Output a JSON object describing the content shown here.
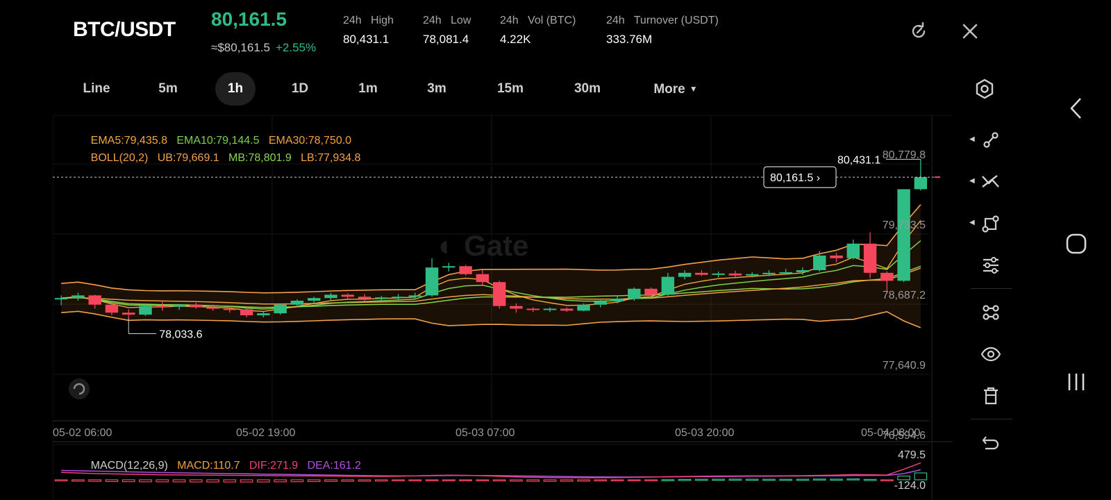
{
  "header": {
    "pair": "BTC/USDT",
    "price": "80,161.5",
    "fiat_price": "≈$80,161.5",
    "change": "+2.55%",
    "stats": [
      {
        "label": "24h   High",
        "value": "80,431.1"
      },
      {
        "label": "24h   Low",
        "value": "78,081.4"
      },
      {
        "label": "24h   Vol (BTC)",
        "value": "4.22K"
      },
      {
        "label": "24h   Turnover (USDT)",
        "value": "333.76M"
      }
    ]
  },
  "intervals": [
    "Line",
    "5m",
    "1h",
    "1D",
    "1m",
    "3m",
    "15m",
    "30m"
  ],
  "more_label": "More",
  "selected_interval": "1h",
  "watermark": "Gate",
  "legend": {
    "ema5": "EMA5:79,435.8",
    "ema10": "EMA10:79,144.5",
    "ema30": "EMA30:78,750.0",
    "boll": "BOLL(20,2)",
    "ub": "UB:79,669.1",
    "mb": "MB:78,801.9",
    "lb": "LB:77,934.8"
  },
  "macd": {
    "title": "MACD(12,26,9)",
    "macd": "MACD:110.7",
    "dif": "DIF:271.9",
    "dea": "DEA:161.2",
    "top_label": "479.5",
    "bottom_label": "-124.0"
  },
  "colors": {
    "up": "#2ebd85",
    "down": "#f6465d",
    "ema5": "#f0a93b",
    "ema10": "#7fd04a",
    "ema30": "#f0a040",
    "boll_ub": "#f5a04a",
    "boll_mb": "#8bd44a",
    "boll_lb": "#f5a04a",
    "dif": "#f0407a",
    "dea": "#b44fe0",
    "macd_label": "#f0a040"
  },
  "chart_data": {
    "type": "candlestick",
    "x_ticks": [
      "05-02 06:00",
      "05-02 19:00",
      "05-03 07:00",
      "05-03 20:00",
      "05-04 08:00"
    ],
    "y_ticks": [
      "80,779.8",
      "79,733.5",
      "78,687.2",
      "77,640.9",
      "76,594.6"
    ],
    "ylim": [
      76594.6,
      80779.8
    ],
    "current_price": "80,161.5",
    "max_label": "80,431.1",
    "min_label": "78,033.6",
    "candles": [
      [
        78320,
        78380,
        78230,
        78340
      ],
      [
        78340,
        78420,
        78300,
        78380
      ],
      [
        78380,
        78390,
        78180,
        78240
      ],
      [
        78240,
        78270,
        78080,
        78120
      ],
      [
        78120,
        78170,
        78034,
        78090
      ],
      [
        78090,
        78240,
        78070,
        78220
      ],
      [
        78220,
        78300,
        78150,
        78210
      ],
      [
        78210,
        78250,
        78160,
        78240
      ],
      [
        78240,
        78270,
        78180,
        78200
      ],
      [
        78200,
        78240,
        78150,
        78180
      ],
      [
        78180,
        78220,
        78120,
        78170
      ],
      [
        78170,
        78190,
        78050,
        78080
      ],
      [
        78080,
        78140,
        78050,
        78110
      ],
      [
        78110,
        78260,
        78090,
        78240
      ],
      [
        78240,
        78320,
        78200,
        78300
      ],
      [
        78300,
        78360,
        78270,
        78340
      ],
      [
        78340,
        78420,
        78300,
        78390
      ],
      [
        78390,
        78410,
        78320,
        78360
      ],
      [
        78360,
        78400,
        78300,
        78330
      ],
      [
        78330,
        78370,
        78290,
        78350
      ],
      [
        78350,
        78400,
        78320,
        78360
      ],
      [
        78360,
        78420,
        78320,
        78380
      ],
      [
        78380,
        78940,
        78360,
        78800
      ],
      [
        78800,
        78870,
        78740,
        78820
      ],
      [
        78820,
        78840,
        78680,
        78700
      ],
      [
        78700,
        78760,
        78520,
        78580
      ],
      [
        78580,
        78600,
        78180,
        78220
      ],
      [
        78220,
        78260,
        78120,
        78180
      ],
      [
        78180,
        78200,
        78130,
        78170
      ],
      [
        78170,
        78200,
        78130,
        78180
      ],
      [
        78180,
        78200,
        78130,
        78150
      ],
      [
        78150,
        78260,
        78140,
        78240
      ],
      [
        78240,
        78310,
        78200,
        78290
      ],
      [
        78290,
        78380,
        78260,
        78330
      ],
      [
        78330,
        78500,
        78300,
        78480
      ],
      [
        78480,
        78500,
        78360,
        78390
      ],
      [
        78390,
        78720,
        78370,
        78660
      ],
      [
        78660,
        78760,
        78620,
        78720
      ],
      [
        78720,
        78760,
        78670,
        78690
      ],
      [
        78690,
        78740,
        78650,
        78710
      ],
      [
        78710,
        78750,
        78660,
        78680
      ],
      [
        78680,
        78730,
        78650,
        78700
      ],
      [
        78700,
        78760,
        78670,
        78720
      ],
      [
        78720,
        78780,
        78690,
        78730
      ],
      [
        78730,
        78800,
        78690,
        78760
      ],
      [
        78760,
        79050,
        78740,
        78980
      ],
      [
        78980,
        79020,
        78880,
        78940
      ],
      [
        78940,
        79220,
        78920,
        79160
      ],
      [
        79160,
        79330,
        78640,
        78720
      ],
      [
        78720,
        78740,
        78420,
        78600
      ],
      [
        78600,
        79860,
        78580,
        79980
      ],
      [
        79980,
        80431,
        79960,
        80161
      ]
    ],
    "macd_hist": [
      -18,
      -22,
      -25,
      -28,
      -30,
      -32,
      -33,
      -34,
      -35,
      -35,
      -36,
      -36,
      -35,
      -33,
      -31,
      -28,
      -26,
      -24,
      -22,
      -20,
      -16,
      -10,
      -6,
      -4,
      -8,
      -12,
      -18,
      -22,
      -24,
      -25,
      -24,
      -22,
      -18,
      -14,
      -10,
      -4,
      2,
      6,
      8,
      9,
      10,
      9,
      8,
      7,
      8,
      12,
      10,
      14,
      6,
      -4,
      60,
      110.7
    ],
    "dif": [
      120,
      110,
      100,
      95,
      90,
      85,
      80,
      78,
      76,
      74,
      72,
      70,
      68,
      66,
      64,
      62,
      60,
      58,
      56,
      55,
      58,
      64,
      70,
      74,
      72,
      66,
      56,
      46,
      40,
      36,
      34,
      33,
      34,
      36,
      40,
      44,
      50,
      54,
      58,
      60,
      62,
      63,
      64,
      65,
      66,
      72,
      76,
      84,
      82,
      76,
      170,
      271.9
    ],
    "dea": [
      150,
      145,
      140,
      135,
      128,
      122,
      116,
      112,
      108,
      104,
      100,
      96,
      92,
      88,
      84,
      80,
      76,
      72,
      68,
      65,
      64,
      64,
      66,
      68,
      69,
      69,
      67,
      64,
      60,
      56,
      52,
      48,
      46,
      45,
      45,
      46,
      47,
      49,
      51,
      53,
      55,
      57,
      58,
      60,
      61,
      63,
      65,
      68,
      71,
      72,
      100,
      161.2
    ]
  },
  "tools": [
    "draw-line-icon",
    "trend-tool-icon",
    "shape-tool-icon",
    "indicator-settings-icon",
    "template-icon",
    "visibility-icon",
    "delete-icon",
    "undo-icon"
  ]
}
